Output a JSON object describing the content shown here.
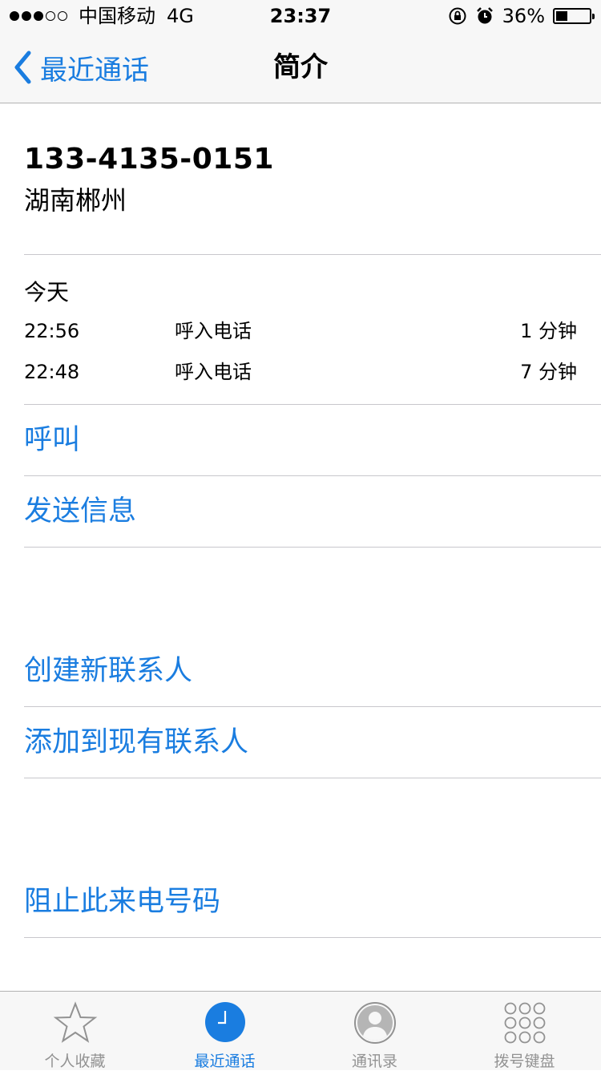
{
  "status_bar": {
    "carrier": "中国移动",
    "network": "4G",
    "time": "23:37",
    "battery_percent": "36%",
    "battery_level": 0.36,
    "signal_bars_filled": 3,
    "signal_bars_total": 5
  },
  "nav": {
    "back_label": "最近通话",
    "title": "简介"
  },
  "contact": {
    "phone": "133-4135-0151",
    "location": "湖南郴州"
  },
  "calls": {
    "day_label": "今天",
    "items": [
      {
        "time": "22:56",
        "type": "呼入电话",
        "duration": "1 分钟"
      },
      {
        "time": "22:48",
        "type": "呼入电话",
        "duration": "7 分钟"
      }
    ]
  },
  "actions": {
    "call": "呼叫",
    "message": "发送信息",
    "create_contact": "创建新联系人",
    "add_to_contact": "添加到现有联系人",
    "block": "阻止此来电号码"
  },
  "tabs": [
    {
      "label": "个人收藏",
      "icon": "star-icon"
    },
    {
      "label": "最近通话",
      "icon": "clock-icon"
    },
    {
      "label": "通讯录",
      "icon": "contacts-icon"
    },
    {
      "label": "拨号键盘",
      "icon": "keypad-icon"
    }
  ],
  "colors": {
    "accent": "#1a7de0",
    "inactive_tab": "#929292"
  }
}
